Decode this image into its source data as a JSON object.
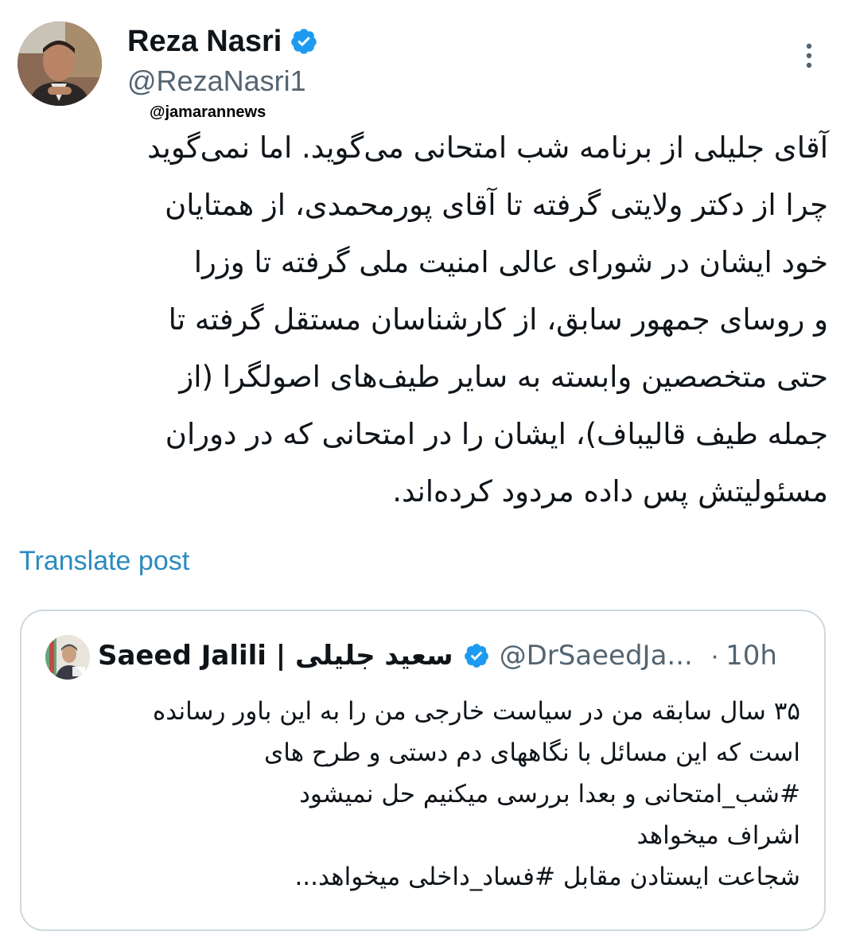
{
  "author": {
    "display_name": "Reza Nasri",
    "handle": "@RezaNasri1",
    "avatar_icon": "profile-photo"
  },
  "watermark": "@jamarannews",
  "tweet": {
    "text": "آقای جلیلی از برنامه شب امتحانی می‌گوید. اما نمی‌گوید\nچرا از دکتر ولایتی گرفته تا آقای پورمحمدی، از همتایان\nخود ایشان در شورای عالی امنیت ملی گرفته تا وزرا\nو روسای جمهور سابق، از  کارشناسان مستقل گرفته تا\nحتی متخصصین وابسته به سایر طیف‌های اصولگرا (از\nجمله طیف قالیباف)، ایشان را در امتحانی که در دوران\nمسئولیتش پس داده مردود کرده‌اند."
  },
  "translate_label": "Translate post",
  "quote": {
    "display_name": "Saeed Jalili | سعید جلیلی",
    "handle": "@DrSaeedJa...",
    "separator": "·",
    "time": "10h",
    "text": "۳۵ سال سابقه من در سیاست خارجی من را به این باور رسانده\nاست که این مسائل با نگاههای دم دستی و طرح های\n#شب_امتحانی و بعدا بررسی میکنیم حل نمیشود\nاشراف میخواهد\nشجاعت ایستادن مقابل #فساد_داخلی میخواهد..."
  },
  "colors": {
    "verified": "#1d9bf0",
    "link": "#2a8bbf",
    "secondary_text": "#536471",
    "border": "#cfd9de"
  }
}
